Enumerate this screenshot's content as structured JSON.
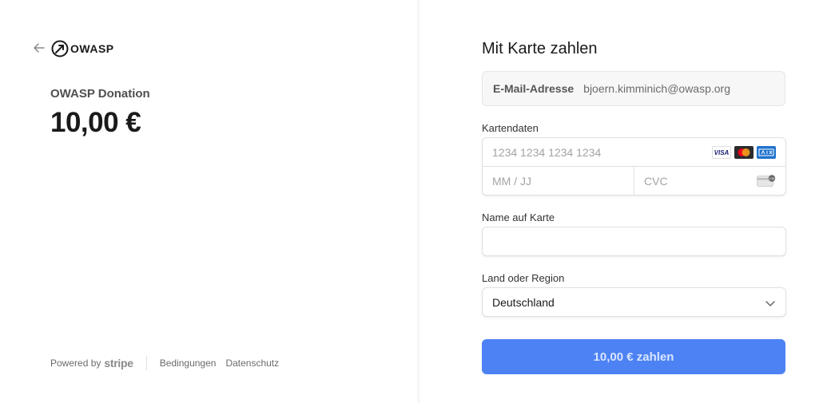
{
  "left": {
    "logo_text": "OWASP",
    "product_name": "OWASP Donation",
    "amount": "10,00 €",
    "footer": {
      "powered_by": "Powered by",
      "stripe": "stripe",
      "terms": "Bedingungen",
      "privacy": "Datenschutz"
    }
  },
  "right": {
    "title": "Mit Karte zahlen",
    "email_label": "E-Mail-Adresse",
    "email_value": "bjoern.kimminich@owasp.org",
    "card_label": "Kartendaten",
    "card_number_placeholder": "1234 1234 1234 1234",
    "expiry_placeholder": "MM / JJ",
    "cvc_placeholder": "CVC",
    "card_brands": [
      "VISA",
      "mastercard",
      "AMEX"
    ],
    "name_label": "Name auf Karte",
    "name_value": "",
    "country_label": "Land oder Region",
    "country_value": "Deutschland",
    "pay_button": "10,00 € zahlen"
  },
  "colors": {
    "button_bg": "#4d82f5",
    "button_text": "#d9e6ff",
    "email_bg": "#f7f7f7"
  }
}
